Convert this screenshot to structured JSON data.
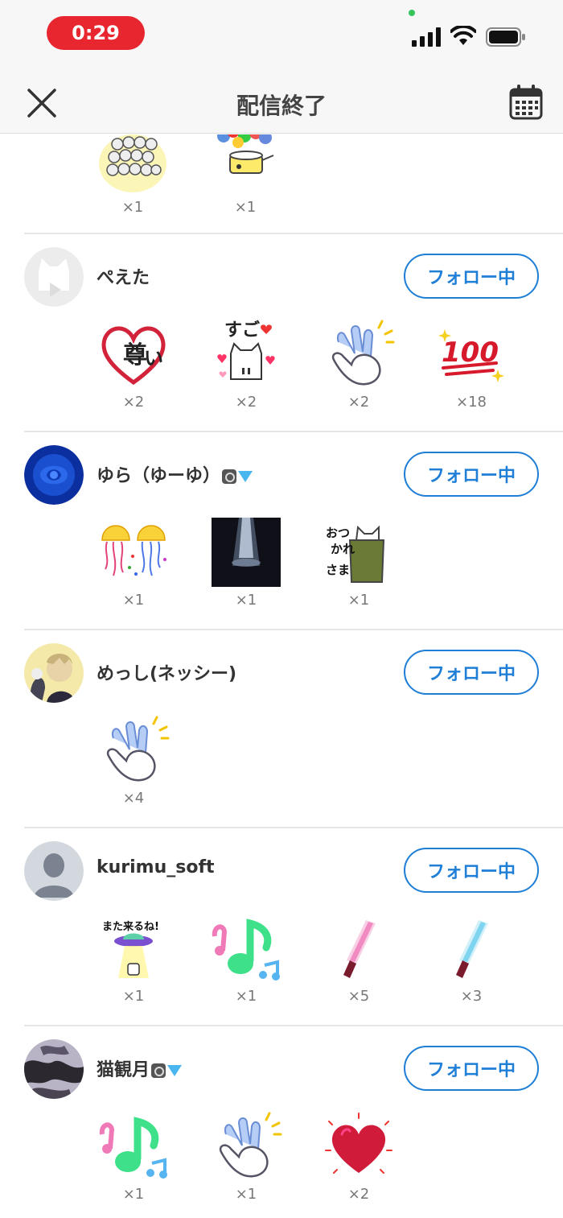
{
  "status": {
    "time": "0:29"
  },
  "header": {
    "title": "配信終了"
  },
  "follow_label": "フォロー中",
  "top_gifts": [
    {
      "icon": "towels-stack-icon",
      "count": "×1"
    },
    {
      "icon": "balloons-bucket-icon",
      "count": "×1"
    }
  ],
  "users": [
    {
      "name": "ぺえた",
      "avatar": "default-cat-avatar",
      "badges": [],
      "gifts": [
        {
          "icon": "heart-toutoi-icon",
          "count": "×2"
        },
        {
          "icon": "sugoi-cat-icon",
          "count": "×2"
        },
        {
          "icon": "clapping-hands-icon",
          "count": "×2"
        },
        {
          "icon": "hundred-points-icon",
          "count": "×18"
        }
      ]
    },
    {
      "name": "ゆら（ゆーゆ）",
      "avatar": "blue-rose-avatar",
      "badges": [
        "instagram-badge-icon",
        "diamond-badge-icon"
      ],
      "gifts": [
        {
          "icon": "jellyfish-confetti-icon",
          "count": "×1"
        },
        {
          "icon": "spotlight-icon",
          "count": "×1"
        },
        {
          "icon": "otsukaresama-cat-icon",
          "count": "×1"
        }
      ]
    },
    {
      "name": "めっし(ネッシー)",
      "avatar": "anime-character-avatar",
      "badges": [],
      "gifts": [
        {
          "icon": "clapping-hands-icon",
          "count": "×4"
        }
      ]
    },
    {
      "name": "kurimu_soft",
      "avatar": "default-person-avatar",
      "badges": [],
      "gifts": [
        {
          "icon": "mata-kuru-ne-ufo-icon",
          "count": "×1"
        },
        {
          "icon": "music-notes-icon",
          "count": "×1"
        },
        {
          "icon": "pink-penlight-icon",
          "count": "×5"
        },
        {
          "icon": "blue-penlight-icon",
          "count": "×3"
        }
      ]
    },
    {
      "name": "猫観月",
      "avatar": "camo-pattern-avatar",
      "badges": [
        "instagram-badge-icon",
        "diamond-badge-icon"
      ],
      "gifts": [
        {
          "icon": "music-notes-icon",
          "count": "×1"
        },
        {
          "icon": "clapping-hands-icon",
          "count": "×1"
        },
        {
          "icon": "red-heart-icon",
          "count": "×2"
        }
      ]
    }
  ],
  "colors": {
    "accent": "#1f7fd6",
    "live_pill": "#e8262f"
  }
}
